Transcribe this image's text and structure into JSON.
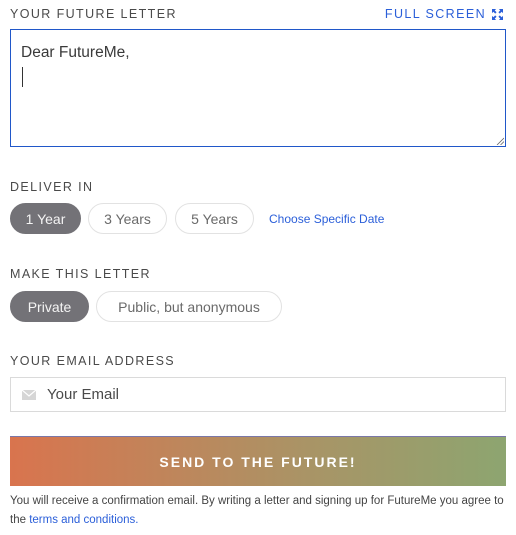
{
  "letter": {
    "label": "YOUR FUTURE LETTER",
    "fullscreen_label": "FULL SCREEN",
    "fullscreen_icon": "expand-arrows-icon",
    "text": "Dear FutureMe,"
  },
  "deliver": {
    "label": "DELIVER IN",
    "options": [
      {
        "label": "1 Year",
        "selected": true
      },
      {
        "label": "3 Years",
        "selected": false
      },
      {
        "label": "5 Years",
        "selected": false
      }
    ],
    "specific_date_link": "Choose Specific Date"
  },
  "privacy": {
    "label": "MAKE THIS LETTER",
    "options": [
      {
        "label": "Private",
        "selected": true
      },
      {
        "label": "Public, but anonymous",
        "selected": false
      }
    ]
  },
  "email": {
    "label": "YOUR EMAIL ADDRESS",
    "placeholder": "Your Email",
    "value": "",
    "icon": "envelope-icon"
  },
  "submit": {
    "label": "SEND TO THE FUTURE!"
  },
  "fine_print": {
    "text": "You will receive a confirmation email. By writing a letter and signing up for FutureMe you agree to the ",
    "link": "terms and conditions."
  },
  "colors": {
    "accent_blue": "#2b5fd9",
    "pill_selected": "#737277",
    "gradient_start": "#d9744e",
    "gradient_end": "#8da570"
  }
}
